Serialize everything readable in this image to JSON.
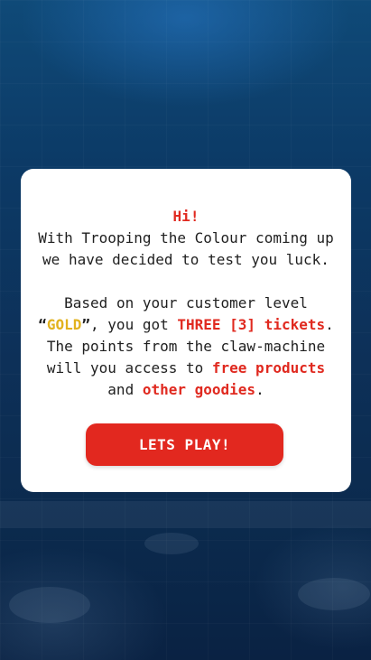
{
  "modal": {
    "greeting": "Hi!",
    "intro_line1": "With Trooping the Colour coming up",
    "intro_line2": "we have decided to test you luck.",
    "level_line1": "Based on your customer level",
    "open_quote": "“",
    "level_name": "GOLD",
    "close_quote": "”",
    "got_text": ", you got ",
    "tickets_text": "THREE [3] tickets",
    "period1": ".",
    "points_line1": "The points from the claw-machine",
    "points_line2_prefix": "will you access to ",
    "free_products": "free products",
    "and_text": "and ",
    "other_goodies": "other goodies",
    "period2": "."
  },
  "cta": {
    "label": "LETS PLAY!"
  },
  "colors": {
    "accent_red": "#e0291f",
    "gold": "#e2b21e",
    "background": "#0b2547"
  }
}
